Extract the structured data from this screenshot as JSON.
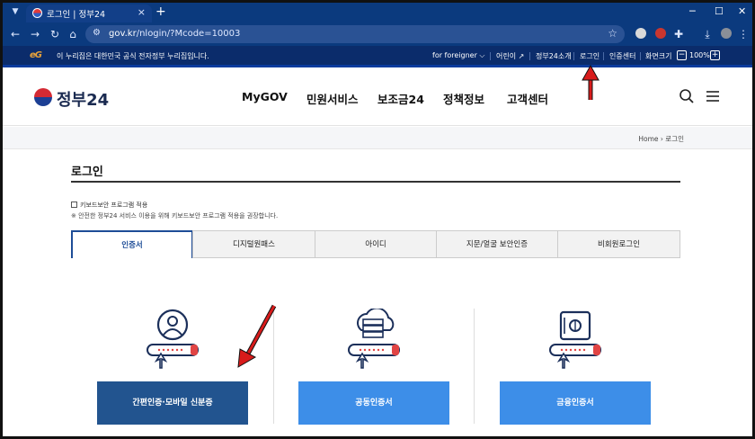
{
  "browser": {
    "tab_title": "로그인 | 정부24",
    "tab_close": "×",
    "new_tab": "+",
    "url_domain": "gov.kr",
    "url_path": "/nlogin/?Mcode=10003",
    "window_minimize": "─",
    "window_maximize": "☐",
    "window_close": "✕"
  },
  "gov_banner": {
    "emblem_text": "eG",
    "notice": "이 누리집은 대한민국 공식 전자정부 누리집입니다.",
    "links": [
      "for foreigner",
      "어린이",
      "정부24소개",
      "로그인",
      "인증센터",
      "화면크기"
    ],
    "zoom_level": "100%",
    "zoom_out": "−",
    "zoom_in": "+"
  },
  "header": {
    "logo_text": "정부24",
    "nav": [
      "MyGOV",
      "민원서비스",
      "보조금24",
      "정책정보",
      "고객센터"
    ]
  },
  "breadcrumb": {
    "home": "Home",
    "current": "로그인"
  },
  "page": {
    "title": "로그인",
    "keyboard_security_label": "키보드보안 프로그램 적용",
    "keyboard_security_note": "※ 안전한 정부24 서비스 이용을 위해 키보드보안 프로그램 적용을 권장합니다.",
    "login_tabs": [
      "인증서",
      "디지털원패스",
      "아이디",
      "지문/얼굴 보안인증",
      "비회원로그인"
    ],
    "active_tab": "인증서",
    "cert_buttons": [
      "간편인증·모바일 신분증",
      "공동인증서",
      "금융인증서"
    ]
  },
  "colors": {
    "chrome": "#0b3a7e",
    "gov_bar": "#0b2c6b",
    "accent": "#1e4d97",
    "btn_dark": "#22548f",
    "btn_light": "#3d8ee8",
    "annotation": "#d81b1b"
  }
}
